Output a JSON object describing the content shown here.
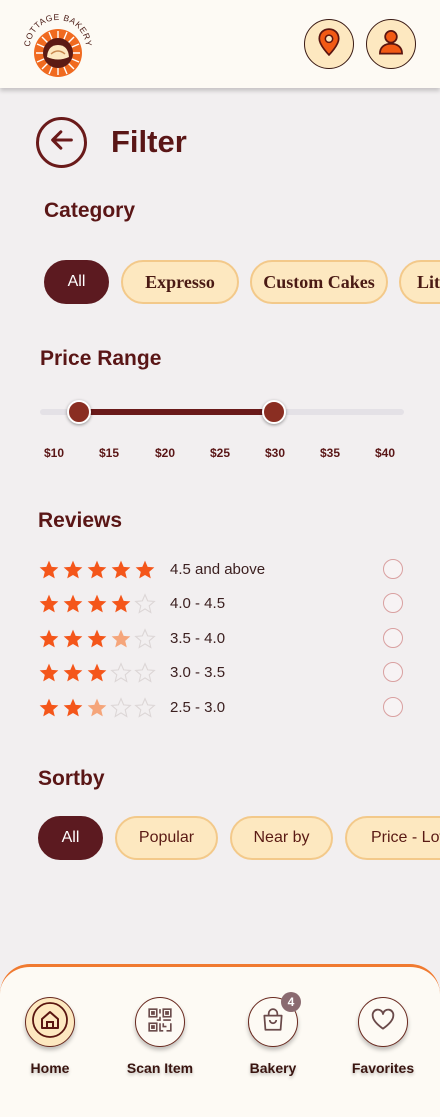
{
  "header": {
    "logo_text": "COTTAGE BAKERY",
    "location_icon": "map-pin-icon",
    "profile_icon": "user-icon"
  },
  "page": {
    "title": "Filter",
    "back_icon": "arrow-left-icon"
  },
  "category": {
    "title": "Category",
    "chips": [
      "All",
      "Expresso",
      "Custom Cakes",
      "Little Cakes"
    ],
    "selected": "All"
  },
  "price_range": {
    "title": "Price Range",
    "ticks": [
      "$10",
      "$15",
      "$20",
      "$25",
      "$30",
      "$35",
      "$40"
    ],
    "min_value": "$15",
    "max_value": "$30"
  },
  "reviews": {
    "title": "Reviews",
    "options": [
      {
        "label": "4.5 and above",
        "stars": 5
      },
      {
        "label": "4.0 - 4.5",
        "stars": 4
      },
      {
        "label": "3.5 - 4.0",
        "stars": 3.5
      },
      {
        "label": "3.0 - 3.5",
        "stars": 3
      },
      {
        "label": "2.5 - 3.0",
        "stars": 2.5
      }
    ]
  },
  "sortby": {
    "title": "Sortby",
    "chips": [
      "All",
      "Popular",
      "Near by",
      "Price - Low to High"
    ],
    "selected": "All"
  },
  "bottom_nav": {
    "items": [
      {
        "label": "Home",
        "icon": "home-icon"
      },
      {
        "label": "Scan Item",
        "icon": "qr-code-icon"
      },
      {
        "label": "Bakery",
        "icon": "shopping-bag-icon",
        "badge": "4"
      },
      {
        "label": "Favorites",
        "icon": "heart-icon"
      }
    ]
  },
  "colors": {
    "accent": "#5c1a20",
    "chip_bg": "#fde8c0",
    "star": "#f4561a",
    "star_half": "#f5a57a",
    "nav_border": "#f07a30"
  }
}
